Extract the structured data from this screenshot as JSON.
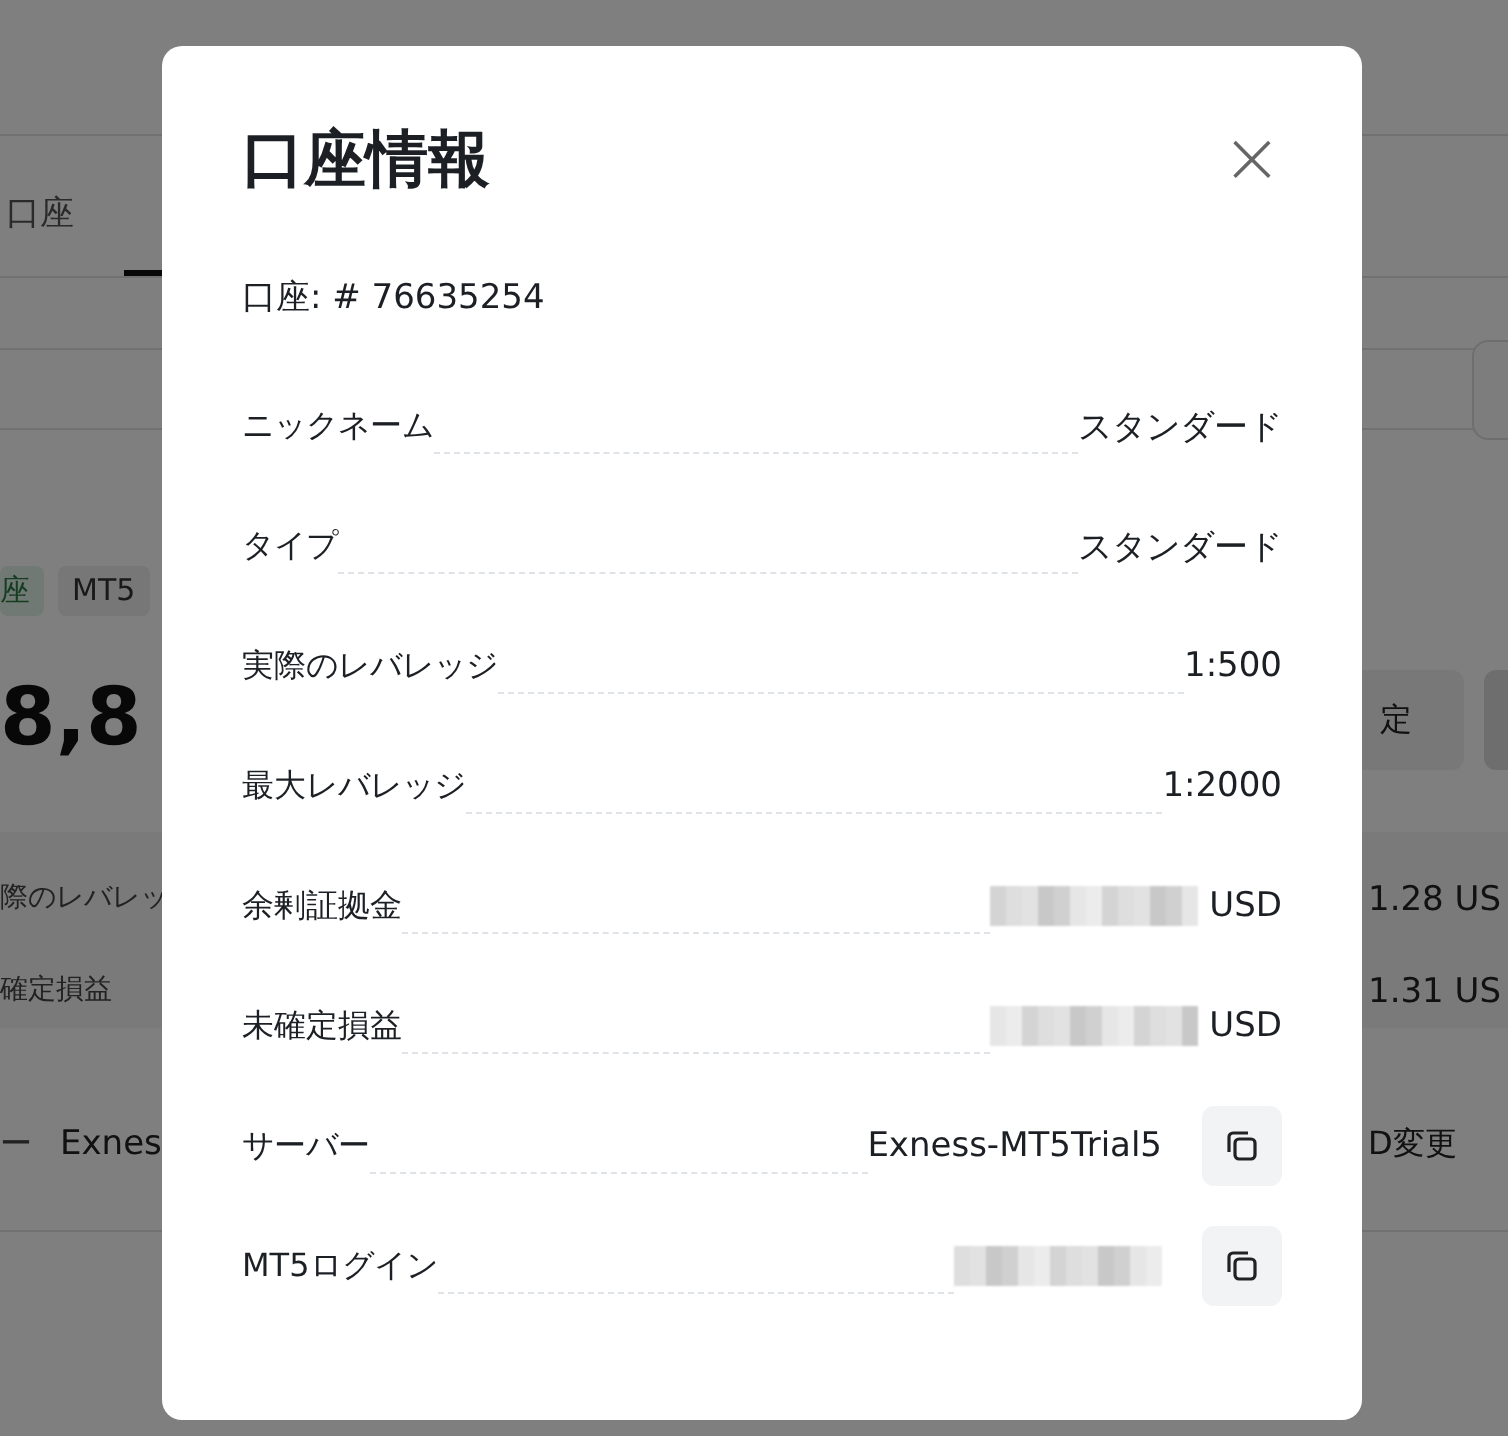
{
  "background": {
    "tab": "口座",
    "tags": [
      "座",
      "MT5"
    ],
    "balance": "8,8",
    "settings_button": "定",
    "summary": [
      {
        "label": "際のレバレッ",
        "value": "1.28 US"
      },
      {
        "label": "確定損益",
        "value": "1.31 US"
      }
    ],
    "server_label": "ー",
    "server_value": "Exnes",
    "change_link": "D変更"
  },
  "modal": {
    "title": "口座情報",
    "account": "口座:  # 76635254",
    "close": "×",
    "rows": [
      {
        "label": "ニックネーム",
        "kind": "text",
        "value": "スタンダード",
        "copy": false
      },
      {
        "label": "タイプ",
        "kind": "text",
        "value": "スタンダード",
        "copy": false
      },
      {
        "label": "実際のレバレッジ",
        "kind": "text",
        "value": "1:500",
        "copy": false
      },
      {
        "label": "最大レバレッジ",
        "kind": "text",
        "value": "1:2000",
        "copy": false
      },
      {
        "label": "余剰証拠金",
        "kind": "masked",
        "unit": "USD",
        "copy": false
      },
      {
        "label": "未確定損益",
        "kind": "masked",
        "unit": "USD",
        "copy": false
      },
      {
        "label": "サーバー",
        "kind": "text",
        "value": "Exness-MT5Trial5",
        "copy": true
      },
      {
        "label": "MT5ログイン",
        "kind": "masked",
        "copy": true
      }
    ]
  }
}
